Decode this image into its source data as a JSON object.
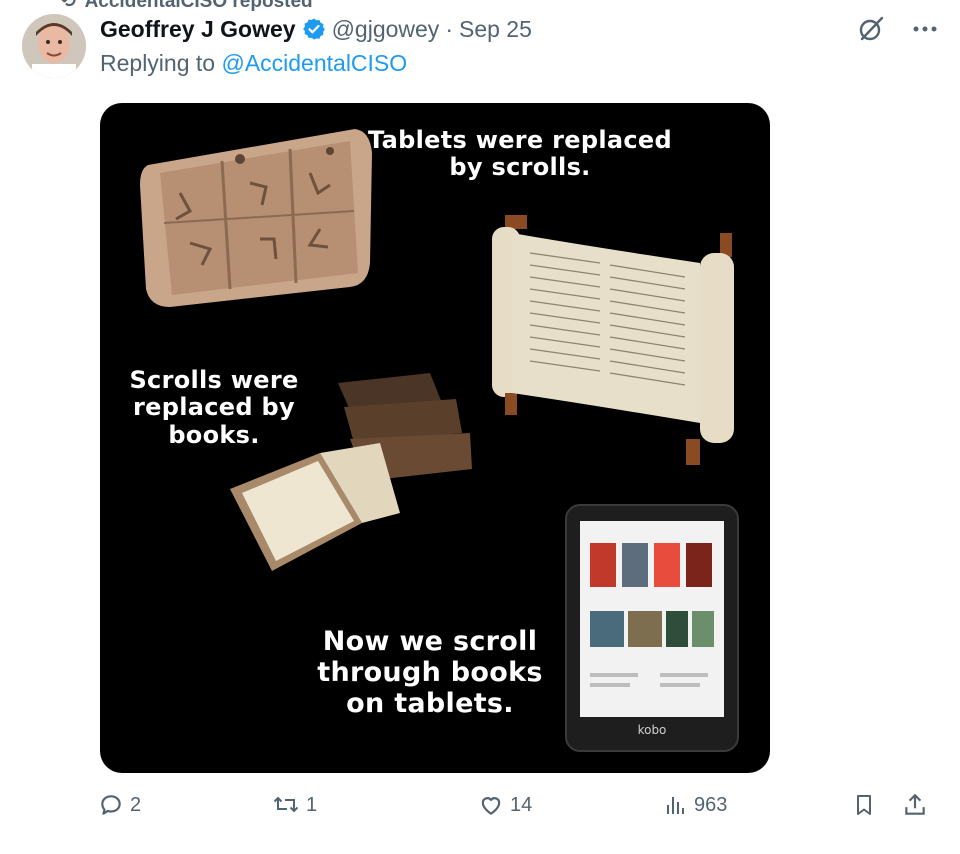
{
  "repost_banner": {
    "text": "AccidentalCISO reposted"
  },
  "tweet": {
    "author_name": "Geoffrey J Gowey",
    "handle": "@gjgowey",
    "separator": "·",
    "date": "Sep 25",
    "replying_prefix": "Replying to",
    "replying_to": "@AccidentalCISO"
  },
  "media": {
    "caption_1": "Tablets were replaced\nby scrolls.",
    "caption_2": "Scrolls were\nreplaced by\nbooks.",
    "caption_3": "Now we scroll\nthrough books\non tablets.",
    "ereader_brand": "kobo"
  },
  "actions": {
    "replies": "2",
    "reposts": "1",
    "likes": "14",
    "views": "963"
  },
  "colors": {
    "accent": "#1d9bf0",
    "muted": "#536471",
    "text": "#0f1419"
  },
  "icons": [
    "verified-icon",
    "grok-icon",
    "more-icon",
    "reply-icon",
    "repost-icon",
    "like-icon",
    "views-icon",
    "bookmark-icon",
    "share-icon"
  ]
}
